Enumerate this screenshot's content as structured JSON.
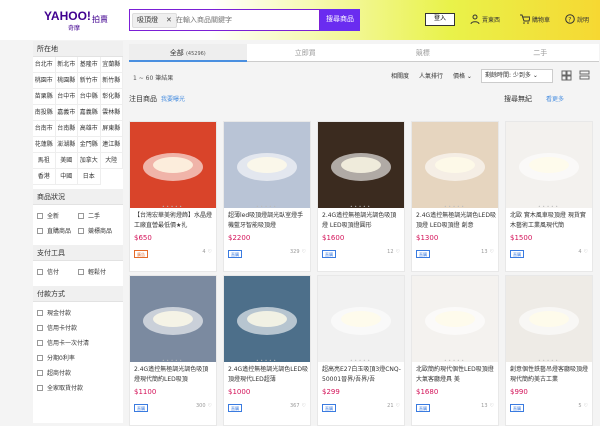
{
  "header": {
    "logo": "YAHOO!",
    "logo_sub": "奇摩",
    "logo_section": "拍賣",
    "search_tag": "吸頂燈",
    "search_tag_close": "✕",
    "search_placeholder": "在輸入商品關鍵字",
    "search_button": "搜尋商品",
    "login": "登入",
    "links": [
      "賣東西",
      "購物車",
      "說明"
    ]
  },
  "sidebar": {
    "location_title": "所在地",
    "regions": [
      "台北市",
      "新北市",
      "基隆市",
      "宜蘭縣",
      "桃園市",
      "桃園縣",
      "新竹市",
      "新竹縣",
      "苗栗縣",
      "台中市",
      "台中縣",
      "彰化縣",
      "南投縣",
      "嘉義市",
      "嘉義縣",
      "雲林縣",
      "台南市",
      "台南縣",
      "高雄市",
      "屏東縣",
      "花蓮縣",
      "澎湖縣",
      "金門縣",
      "連江縣",
      "馬祖",
      "美國",
      "加拿大",
      "大陸",
      "香港",
      "中國",
      "日本"
    ],
    "condition_title": "商品狀況",
    "conditions": [
      "全新",
      "二手",
      "直購商品",
      "競標商品"
    ],
    "payment_title": "支付工具",
    "payments": [
      "信付",
      "輕鬆付"
    ],
    "paymode_title": "付款方式",
    "paymodes": [
      "現金付款",
      "信用卡付款",
      "信用卡一次付清",
      "分期0利率",
      "超商付款",
      "全家取貨付款"
    ]
  },
  "tabs": [
    {
      "label": "全部",
      "count": "(45296)"
    },
    {
      "label": "立即買",
      "count": ""
    },
    {
      "label": "競標",
      "count": ""
    },
    {
      "label": "二手",
      "count": ""
    }
  ],
  "results": {
    "count_text": "1 ~ 60 筆結果",
    "sorts": [
      "相關度",
      "人氣排行",
      "價格 ⌄"
    ],
    "sort_select": "剩餘時間: 少到多 ⌄"
  },
  "sections": {
    "left_title": "注目商品",
    "left_link": "我要曝光",
    "right_title": "搜尋無紀",
    "right_link": "看更多"
  },
  "products": [
    {
      "title": "【台灣宏華美術燈飾】水晶燈工廠直營最低價★扎",
      "price": "$650",
      "badge": "廣告",
      "likes": "4",
      "img": "#d9442a"
    },
    {
      "title": "超薄led吸頂燈調光臥室燈手機藍牙智能吸頂燈",
      "price": "$2200",
      "badge": "直購",
      "likes": "329",
      "img": "#b9c4d6"
    },
    {
      "title": "2.4G遙控無極調光調色吸頂燈 LED吸頂燈圓形",
      "price": "$1600",
      "badge": "直購",
      "likes": "12",
      "img": "#3b2b1f"
    },
    {
      "title": "2.4G遙控無極調光調色LED吸頂燈 LED吸頂燈 創意",
      "price": "$1300",
      "badge": "直購",
      "likes": "13",
      "img": "#e6d5bf"
    },
    {
      "title": "北歐 實木風車吸頂燈 現貨實木藝術工業風現代簡",
      "price": "$1500",
      "badge": "直購",
      "likes": "4",
      "img": "#f3f1ee"
    },
    {
      "title": "2.4G遙控無極調光調色吸頂燈現代簡約LED吸頂",
      "price": "$1100",
      "badge": "直購",
      "likes": "300",
      "img": "#7b8aa0"
    },
    {
      "title": "2.4G遙控無極調光調色LED吸頂燈現代LED超薄",
      "price": "$1000",
      "badge": "直購",
      "likes": "367",
      "img": "#4d6f8a"
    },
    {
      "title": "超高亮E27白玉吸頂3燈CNQ-50001晉界/吾界/吾",
      "price": "$299",
      "badge": "直購",
      "likes": "21",
      "img": "#f1f1f1"
    },
    {
      "title": "北歐簡約現代個性LED吸頂燈大氣客廳燈具 美",
      "price": "$1680",
      "badge": "直購",
      "likes": "13",
      "img": "#f4f2ef"
    },
    {
      "title": "創意個性鉄藝吊燈客廳吸頂燈現代簡約美古工業",
      "price": "$990",
      "badge": "直購",
      "likes": "5",
      "img": "#eeebe6"
    }
  ],
  "colors": {
    "accent": "#6a2cf0",
    "price": "#d4145a",
    "link": "#4a8fe0"
  }
}
